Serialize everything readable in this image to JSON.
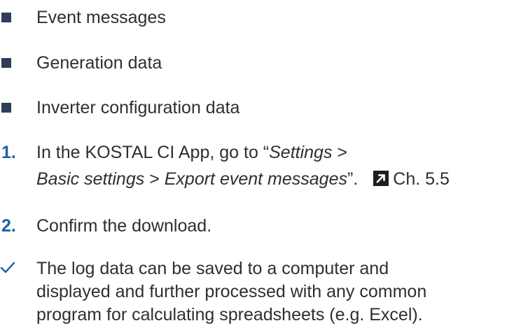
{
  "bullets": [
    "Event messages",
    "Generation data",
    "Inverter configuration data"
  ],
  "steps": [
    {
      "number": "1.",
      "line1_prefix": "In the KOSTAL CI App, go to “",
      "line1_italic": "Settings",
      "line1_suffix": " >",
      "line2_italic_a": "Basic settings",
      "line2_sep": " > ",
      "line2_italic_b": "Export event messages",
      "line2_end": "”.",
      "reference": "Ch. 5.5"
    },
    {
      "number": "2.",
      "text": "Confirm the download."
    }
  ],
  "result": {
    "lines": [
      "The log data can be saved to a computer and",
      "displayed and further processed with any common",
      "program for calculating spreadsheets (e.g. Excel)."
    ]
  },
  "colors": {
    "bullet": "#2d3f55",
    "step_number": "#1f5fa8",
    "check": "#1f5fa8",
    "reference_icon": "#1e1e1e"
  },
  "icons": {
    "reference": "arrow-up-right-icon",
    "result": "check-icon"
  }
}
